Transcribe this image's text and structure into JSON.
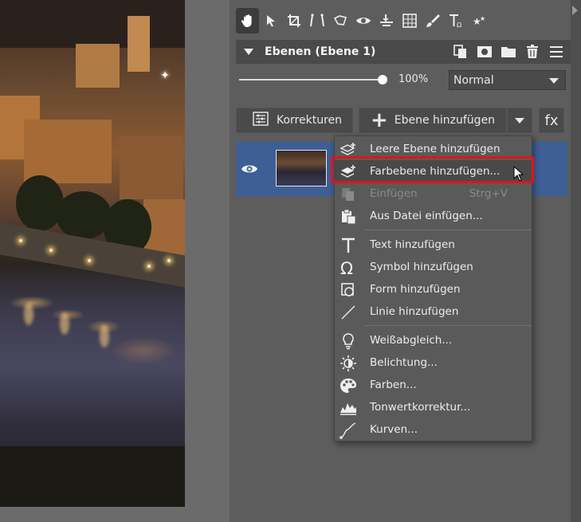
{
  "toolbar": {
    "tools": [
      "hand-icon",
      "pointer-icon",
      "crop-icon",
      "perspective-icon",
      "lasso-icon",
      "eye-icon",
      "align-icon",
      "grid-icon",
      "brush-icon",
      "text-symbol-icon",
      "sparkle-icon"
    ]
  },
  "layers_panel": {
    "title": "Ebenen (Ebene 1)",
    "opacity": "100%",
    "blend_mode": "Normal",
    "adjustments_label": "Korrekturen",
    "add_layer_label": "Ebene hinzufügen",
    "fx_label": "fx"
  },
  "menu": {
    "items": [
      {
        "label": "Leere Ebene hinzufügen",
        "icon": "empty-layer-icon"
      },
      {
        "label": "Farbebene hinzufügen...",
        "icon": "color-layer-icon"
      },
      {
        "label": "Einfügen",
        "shortcut": "Strg+V",
        "icon": "paste-icon"
      },
      {
        "label": "Aus Datei einfügen...",
        "icon": "paste-from-file-icon"
      },
      {
        "label": "Text hinzufügen",
        "icon": "text-icon"
      },
      {
        "label": "Symbol hinzufügen",
        "icon": "omega-icon"
      },
      {
        "label": "Form hinzufügen",
        "icon": "shape-icon"
      },
      {
        "label": "Linie hinzufügen",
        "icon": "line-icon"
      },
      {
        "label": "Weißabgleich...",
        "icon": "bulb-icon"
      },
      {
        "label": "Belichtung...",
        "icon": "exposure-icon"
      },
      {
        "label": "Farben...",
        "icon": "palette-icon"
      },
      {
        "label": "Tonwertkorrektur...",
        "icon": "levels-icon"
      },
      {
        "label": "Kurven...",
        "icon": "curves-icon"
      }
    ]
  },
  "colors": {
    "panel_bg": "#5d5d5d",
    "selected_layer": "#3e5f95",
    "highlight_border": "#e1141b"
  }
}
